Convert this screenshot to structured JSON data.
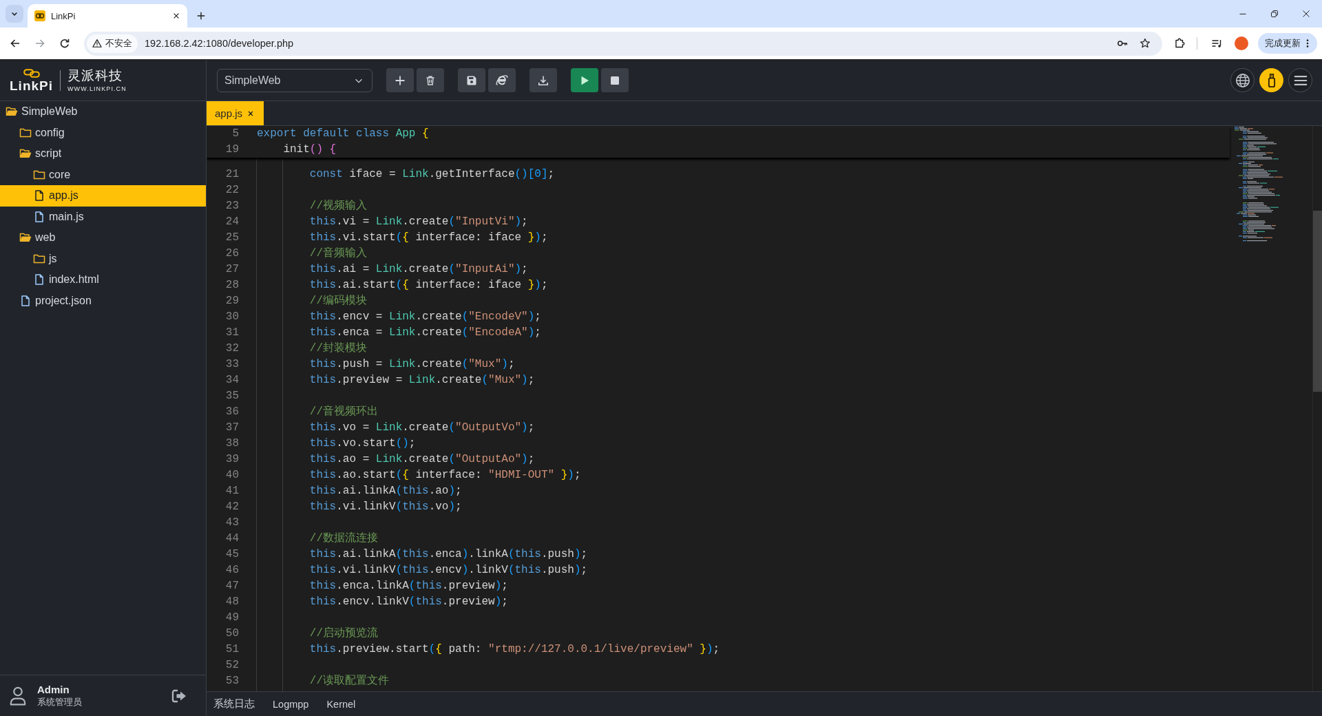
{
  "browser": {
    "tabs": [
      {
        "title": "LinkPi",
        "selected": true
      }
    ],
    "address": {
      "security_label": "不安全",
      "url": "192.168.2.42:1080/developer.php"
    },
    "update_button": "完成更新"
  },
  "app": {
    "logo": {
      "wordmark": "LinkPi",
      "company": "灵派科技",
      "website": "WWW.LINKPI.CN"
    },
    "project_select": {
      "value": "SimpleWeb"
    },
    "file_tree": [
      {
        "name": "SimpleWeb",
        "kind": "folder",
        "expanded": true,
        "selected": false,
        "children": [
          {
            "name": "config",
            "kind": "folder",
            "expanded": false,
            "selected": false
          },
          {
            "name": "script",
            "kind": "folder",
            "expanded": true,
            "selected": false,
            "children": [
              {
                "name": "core",
                "kind": "folder",
                "expanded": false,
                "selected": false
              },
              {
                "name": "app.js",
                "kind": "file",
                "selected": true
              },
              {
                "name": "main.js",
                "kind": "file",
                "selected": false
              }
            ]
          },
          {
            "name": "web",
            "kind": "folder",
            "expanded": true,
            "selected": false,
            "children": [
              {
                "name": "js",
                "kind": "folder",
                "expanded": false,
                "selected": false
              },
              {
                "name": "index.html",
                "kind": "file",
                "selected": false
              }
            ]
          },
          {
            "name": "project.json",
            "kind": "file",
            "selected": false
          }
        ]
      }
    ],
    "user": {
      "name": "Admin",
      "role": "系统管理员"
    },
    "editor": {
      "tabs": [
        {
          "label": "app.js",
          "selected": true
        }
      ],
      "code": [
        {
          "number": "5",
          "tokens": [
            {
              "kind": "kw",
              "text": "export default class "
            },
            {
              "kind": "type",
              "text": "App"
            },
            {
              "kind": "b1",
              "text": " {"
            }
          ],
          "children": [
            {
              "number": "19",
              "tokens": [
                {
                  "kind": "plain",
                  "text": "init"
                },
                {
                  "kind": "b2",
                  "text": "() {"
                }
              ],
              "children": [
                {
                  "number": "21",
                  "tokens": [
                    {
                      "kind": "kw",
                      "text": "const"
                    },
                    {
                      "kind": "plain",
                      "text": " iface = "
                    },
                    {
                      "kind": "type",
                      "text": "Link"
                    },
                    {
                      "kind": "plain",
                      "text": ".getInterface"
                    },
                    {
                      "kind": "b3",
                      "text": "()[0]"
                    },
                    {
                      "kind": "plain",
                      "text": ";"
                    }
                  ]
                },
                {
                  "number": "22"
                },
                {
                  "number": "23",
                  "tokens": [
                    {
                      "kind": "comment",
                      "text": "//视频输入"
                    }
                  ]
                },
                {
                  "number": "24",
                  "tokens": [
                    {
                      "kind": "kw",
                      "text": "this"
                    },
                    {
                      "kind": "plain",
                      "text": ".vi = "
                    },
                    {
                      "kind": "type",
                      "text": "Link"
                    },
                    {
                      "kind": "plain",
                      "text": ".create"
                    },
                    {
                      "kind": "b3",
                      "text": "("
                    },
                    {
                      "kind": "str",
                      "text": "\"InputVi\""
                    },
                    {
                      "kind": "b3",
                      "text": ")"
                    },
                    {
                      "kind": "plain",
                      "text": ";"
                    }
                  ]
                },
                {
                  "number": "25",
                  "tokens": [
                    {
                      "kind": "kw",
                      "text": "this"
                    },
                    {
                      "kind": "plain",
                      "text": ".vi.start"
                    },
                    {
                      "kind": "b3",
                      "text": "("
                    },
                    {
                      "kind": "b1",
                      "text": "{"
                    },
                    {
                      "kind": "plain",
                      "text": " interface: iface "
                    },
                    {
                      "kind": "b1",
                      "text": "}"
                    },
                    {
                      "kind": "b3",
                      "text": ")"
                    },
                    {
                      "kind": "plain",
                      "text": ";"
                    }
                  ]
                },
                {
                  "number": "26",
                  "tokens": [
                    {
                      "kind": "comment",
                      "text": "//音频输入"
                    }
                  ]
                },
                {
                  "number": "27",
                  "tokens": [
                    {
                      "kind": "kw",
                      "text": "this"
                    },
                    {
                      "kind": "plain",
                      "text": ".ai = "
                    },
                    {
                      "kind": "type",
                      "text": "Link"
                    },
                    {
                      "kind": "plain",
                      "text": ".create"
                    },
                    {
                      "kind": "b3",
                      "text": "("
                    },
                    {
                      "kind": "str",
                      "text": "\"InputAi\""
                    },
                    {
                      "kind": "b3",
                      "text": ")"
                    },
                    {
                      "kind": "plain",
                      "text": ";"
                    }
                  ]
                },
                {
                  "number": "28",
                  "tokens": [
                    {
                      "kind": "kw",
                      "text": "this"
                    },
                    {
                      "kind": "plain",
                      "text": ".ai.start"
                    },
                    {
                      "kind": "b3",
                      "text": "("
                    },
                    {
                      "kind": "b1",
                      "text": "{"
                    },
                    {
                      "kind": "plain",
                      "text": " interface: iface "
                    },
                    {
                      "kind": "b1",
                      "text": "}"
                    },
                    {
                      "kind": "b3",
                      "text": ")"
                    },
                    {
                      "kind": "plain",
                      "text": ";"
                    }
                  ]
                },
                {
                  "number": "29",
                  "tokens": [
                    {
                      "kind": "comment",
                      "text": "//编码模块"
                    }
                  ]
                },
                {
                  "number": "30",
                  "tokens": [
                    {
                      "kind": "kw",
                      "text": "this"
                    },
                    {
                      "kind": "plain",
                      "text": ".encv = "
                    },
                    {
                      "kind": "type",
                      "text": "Link"
                    },
                    {
                      "kind": "plain",
                      "text": ".create"
                    },
                    {
                      "kind": "b3",
                      "text": "("
                    },
                    {
                      "kind": "str",
                      "text": "\"EncodeV\""
                    },
                    {
                      "kind": "b3",
                      "text": ")"
                    },
                    {
                      "kind": "plain",
                      "text": ";"
                    }
                  ]
                },
                {
                  "number": "31",
                  "tokens": [
                    {
                      "kind": "kw",
                      "text": "this"
                    },
                    {
                      "kind": "plain",
                      "text": ".enca = "
                    },
                    {
                      "kind": "type",
                      "text": "Link"
                    },
                    {
                      "kind": "plain",
                      "text": ".create"
                    },
                    {
                      "kind": "b3",
                      "text": "("
                    },
                    {
                      "kind": "str",
                      "text": "\"EncodeA\""
                    },
                    {
                      "kind": "b3",
                      "text": ")"
                    },
                    {
                      "kind": "plain",
                      "text": ";"
                    }
                  ]
                },
                {
                  "number": "32",
                  "tokens": [
                    {
                      "kind": "comment",
                      "text": "//封装模块"
                    }
                  ]
                },
                {
                  "number": "33",
                  "tokens": [
                    {
                      "kind": "kw",
                      "text": "this"
                    },
                    {
                      "kind": "plain",
                      "text": ".push = "
                    },
                    {
                      "kind": "type",
                      "text": "Link"
                    },
                    {
                      "kind": "plain",
                      "text": ".create"
                    },
                    {
                      "kind": "b3",
                      "text": "("
                    },
                    {
                      "kind": "str",
                      "text": "\"Mux\""
                    },
                    {
                      "kind": "b3",
                      "text": ")"
                    },
                    {
                      "kind": "plain",
                      "text": ";"
                    }
                  ]
                },
                {
                  "number": "34",
                  "tokens": [
                    {
                      "kind": "kw",
                      "text": "this"
                    },
                    {
                      "kind": "plain",
                      "text": ".preview = "
                    },
                    {
                      "kind": "type",
                      "text": "Link"
                    },
                    {
                      "kind": "plain",
                      "text": ".create"
                    },
                    {
                      "kind": "b3",
                      "text": "("
                    },
                    {
                      "kind": "str",
                      "text": "\"Mux\""
                    },
                    {
                      "kind": "b3",
                      "text": ")"
                    },
                    {
                      "kind": "plain",
                      "text": ";"
                    }
                  ]
                },
                {
                  "number": "35"
                },
                {
                  "number": "36",
                  "tokens": [
                    {
                      "kind": "comment",
                      "text": "//音视频环出"
                    }
                  ]
                },
                {
                  "number": "37",
                  "tokens": [
                    {
                      "kind": "kw",
                      "text": "this"
                    },
                    {
                      "kind": "plain",
                      "text": ".vo = "
                    },
                    {
                      "kind": "type",
                      "text": "Link"
                    },
                    {
                      "kind": "plain",
                      "text": ".create"
                    },
                    {
                      "kind": "b3",
                      "text": "("
                    },
                    {
                      "kind": "str",
                      "text": "\"OutputVo\""
                    },
                    {
                      "kind": "b3",
                      "text": ")"
                    },
                    {
                      "kind": "plain",
                      "text": ";"
                    }
                  ]
                },
                {
                  "number": "38",
                  "tokens": [
                    {
                      "kind": "kw",
                      "text": "this"
                    },
                    {
                      "kind": "plain",
                      "text": ".vo.start"
                    },
                    {
                      "kind": "b3",
                      "text": "()"
                    },
                    {
                      "kind": "plain",
                      "text": ";"
                    }
                  ]
                },
                {
                  "number": "39",
                  "tokens": [
                    {
                      "kind": "kw",
                      "text": "this"
                    },
                    {
                      "kind": "plain",
                      "text": ".ao = "
                    },
                    {
                      "kind": "type",
                      "text": "Link"
                    },
                    {
                      "kind": "plain",
                      "text": ".create"
                    },
                    {
                      "kind": "b3",
                      "text": "("
                    },
                    {
                      "kind": "str",
                      "text": "\"OutputAo\""
                    },
                    {
                      "kind": "b3",
                      "text": ")"
                    },
                    {
                      "kind": "plain",
                      "text": ";"
                    }
                  ]
                },
                {
                  "number": "40",
                  "tokens": [
                    {
                      "kind": "kw",
                      "text": "this"
                    },
                    {
                      "kind": "plain",
                      "text": ".ao.start"
                    },
                    {
                      "kind": "b3",
                      "text": "("
                    },
                    {
                      "kind": "b1",
                      "text": "{"
                    },
                    {
                      "kind": "plain",
                      "text": " interface: "
                    },
                    {
                      "kind": "str",
                      "text": "\"HDMI-OUT\""
                    },
                    {
                      "kind": "b1",
                      "text": " }"
                    },
                    {
                      "kind": "b3",
                      "text": ")"
                    },
                    {
                      "kind": "plain",
                      "text": ";"
                    }
                  ]
                },
                {
                  "number": "41",
                  "tokens": [
                    {
                      "kind": "kw",
                      "text": "this"
                    },
                    {
                      "kind": "plain",
                      "text": ".ai.linkA"
                    },
                    {
                      "kind": "b3",
                      "text": "("
                    },
                    {
                      "kind": "kw",
                      "text": "this"
                    },
                    {
                      "kind": "plain",
                      "text": ".ao"
                    },
                    {
                      "kind": "b3",
                      "text": ")"
                    },
                    {
                      "kind": "plain",
                      "text": ";"
                    }
                  ]
                },
                {
                  "number": "42",
                  "tokens": [
                    {
                      "kind": "kw",
                      "text": "this"
                    },
                    {
                      "kind": "plain",
                      "text": ".vi.linkV"
                    },
                    {
                      "kind": "b3",
                      "text": "("
                    },
                    {
                      "kind": "kw",
                      "text": "this"
                    },
                    {
                      "kind": "plain",
                      "text": ".vo"
                    },
                    {
                      "kind": "b3",
                      "text": ")"
                    },
                    {
                      "kind": "plain",
                      "text": ";"
                    }
                  ]
                },
                {
                  "number": "43"
                },
                {
                  "number": "44",
                  "tokens": [
                    {
                      "kind": "comment",
                      "text": "//数据流连接"
                    }
                  ]
                },
                {
                  "number": "45",
                  "tokens": [
                    {
                      "kind": "kw",
                      "text": "this"
                    },
                    {
                      "kind": "plain",
                      "text": ".ai.linkA"
                    },
                    {
                      "kind": "b3",
                      "text": "("
                    },
                    {
                      "kind": "kw",
                      "text": "this"
                    },
                    {
                      "kind": "plain",
                      "text": ".enca"
                    },
                    {
                      "kind": "b3",
                      "text": ")"
                    },
                    {
                      "kind": "plain",
                      "text": ".linkA"
                    },
                    {
                      "kind": "b3",
                      "text": "("
                    },
                    {
                      "kind": "kw",
                      "text": "this"
                    },
                    {
                      "kind": "plain",
                      "text": ".push"
                    },
                    {
                      "kind": "b3",
                      "text": ")"
                    },
                    {
                      "kind": "plain",
                      "text": ";"
                    }
                  ]
                },
                {
                  "number": "46",
                  "tokens": [
                    {
                      "kind": "kw",
                      "text": "this"
                    },
                    {
                      "kind": "plain",
                      "text": ".vi.linkV"
                    },
                    {
                      "kind": "b3",
                      "text": "("
                    },
                    {
                      "kind": "kw",
                      "text": "this"
                    },
                    {
                      "kind": "plain",
                      "text": ".encv"
                    },
                    {
                      "kind": "b3",
                      "text": ")"
                    },
                    {
                      "kind": "plain",
                      "text": ".linkV"
                    },
                    {
                      "kind": "b3",
                      "text": "("
                    },
                    {
                      "kind": "kw",
                      "text": "this"
                    },
                    {
                      "kind": "plain",
                      "text": ".push"
                    },
                    {
                      "kind": "b3",
                      "text": ")"
                    },
                    {
                      "kind": "plain",
                      "text": ";"
                    }
                  ]
                },
                {
                  "number": "47",
                  "tokens": [
                    {
                      "kind": "kw",
                      "text": "this"
                    },
                    {
                      "kind": "plain",
                      "text": ".enca.linkA"
                    },
                    {
                      "kind": "b3",
                      "text": "("
                    },
                    {
                      "kind": "kw",
                      "text": "this"
                    },
                    {
                      "kind": "plain",
                      "text": ".preview"
                    },
                    {
                      "kind": "b3",
                      "text": ")"
                    },
                    {
                      "kind": "plain",
                      "text": ";"
                    }
                  ]
                },
                {
                  "number": "48",
                  "tokens": [
                    {
                      "kind": "kw",
                      "text": "this"
                    },
                    {
                      "kind": "plain",
                      "text": ".encv.linkV"
                    },
                    {
                      "kind": "b3",
                      "text": "("
                    },
                    {
                      "kind": "kw",
                      "text": "this"
                    },
                    {
                      "kind": "plain",
                      "text": ".preview"
                    },
                    {
                      "kind": "b3",
                      "text": ")"
                    },
                    {
                      "kind": "plain",
                      "text": ";"
                    }
                  ]
                },
                {
                  "number": "49"
                },
                {
                  "number": "50",
                  "tokens": [
                    {
                      "kind": "comment",
                      "text": "//启动预览流"
                    }
                  ]
                },
                {
                  "number": "51",
                  "tokens": [
                    {
                      "kind": "kw",
                      "text": "this"
                    },
                    {
                      "kind": "plain",
                      "text": ".preview.start"
                    },
                    {
                      "kind": "b3",
                      "text": "("
                    },
                    {
                      "kind": "b1",
                      "text": "{"
                    },
                    {
                      "kind": "plain",
                      "text": " path: "
                    },
                    {
                      "kind": "str",
                      "text": "\"rtmp://127.0.0.1/live/preview\""
                    },
                    {
                      "kind": "b1",
                      "text": " }"
                    },
                    {
                      "kind": "b3",
                      "text": ")"
                    },
                    {
                      "kind": "plain",
                      "text": ";"
                    }
                  ]
                },
                {
                  "number": "52"
                },
                {
                  "number": "53",
                  "tokens": [
                    {
                      "kind": "comment",
                      "text": "//读取配置文件"
                    }
                  ]
                }
              ]
            }
          ]
        }
      ]
    },
    "panel_tabs": [
      "系统日志",
      "Logmpp",
      "Kernel"
    ]
  }
}
